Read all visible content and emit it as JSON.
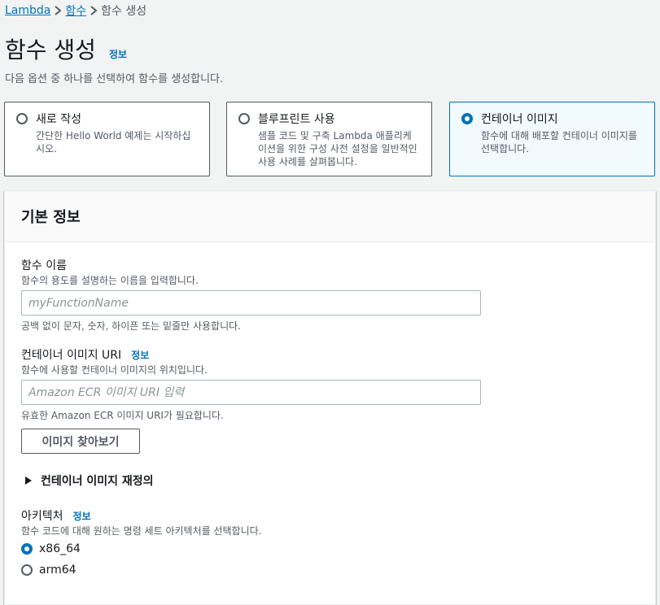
{
  "breadcrumb": {
    "items": [
      "Lambda",
      "함수",
      "함수 생성"
    ]
  },
  "page": {
    "title": "함수 생성",
    "info": "정보",
    "subtitle": "다음 옵션 중 하나를 선택하여 함수를 생성합니다."
  },
  "options": [
    {
      "label": "새로 작성",
      "desc": "간단한 Hello World 예제는 시작하십시오.",
      "selected": false
    },
    {
      "label": "블루프린트 사용",
      "desc": "샘플 코드 및 구축 Lambda 애플리케이션을 위한 구성 사전 설정을 일반적인 사용 사례를 살펴봅니다.",
      "selected": false
    },
    {
      "label": "컨테이너 이미지",
      "desc": "함수에 대해 배포할 컨테이너 이미지를 선택합니다.",
      "selected": true
    }
  ],
  "basic_info": {
    "heading": "기본 정보",
    "function_name": {
      "label": "함수 이름",
      "desc": "함수의 용도를 설명하는 이름을 입력합니다.",
      "placeholder": "myFunctionName",
      "value": "",
      "constraint": "공백 없이 문자, 숫자, 하이픈 또는 밑줄만 사용합니다."
    },
    "image_uri": {
      "label": "컨테이너 이미지 URI",
      "info": "정보",
      "desc": "함수에 사용할 컨테이너 이미지의 위치입니다.",
      "placeholder": "Amazon ECR 이미지 URI 입력",
      "value": "",
      "constraint": "유효한 Amazon ECR 이미지 URI가 필요합니다."
    },
    "browse_button": "이미지 찾아보기",
    "override_expander": "컨테이너 이미지 재정의",
    "architecture": {
      "label": "아키텍처",
      "info": "정보",
      "desc": "함수 코드에 대해 원하는 명령 세트 아키텍처를 선택합니다.",
      "options": [
        {
          "label": "x86_64",
          "selected": true
        },
        {
          "label": "arm64",
          "selected": false
        }
      ]
    }
  },
  "colors": {
    "link": "#0073bb",
    "selected_bg": "#f1faff",
    "page_bg": "#f2f3f3"
  }
}
